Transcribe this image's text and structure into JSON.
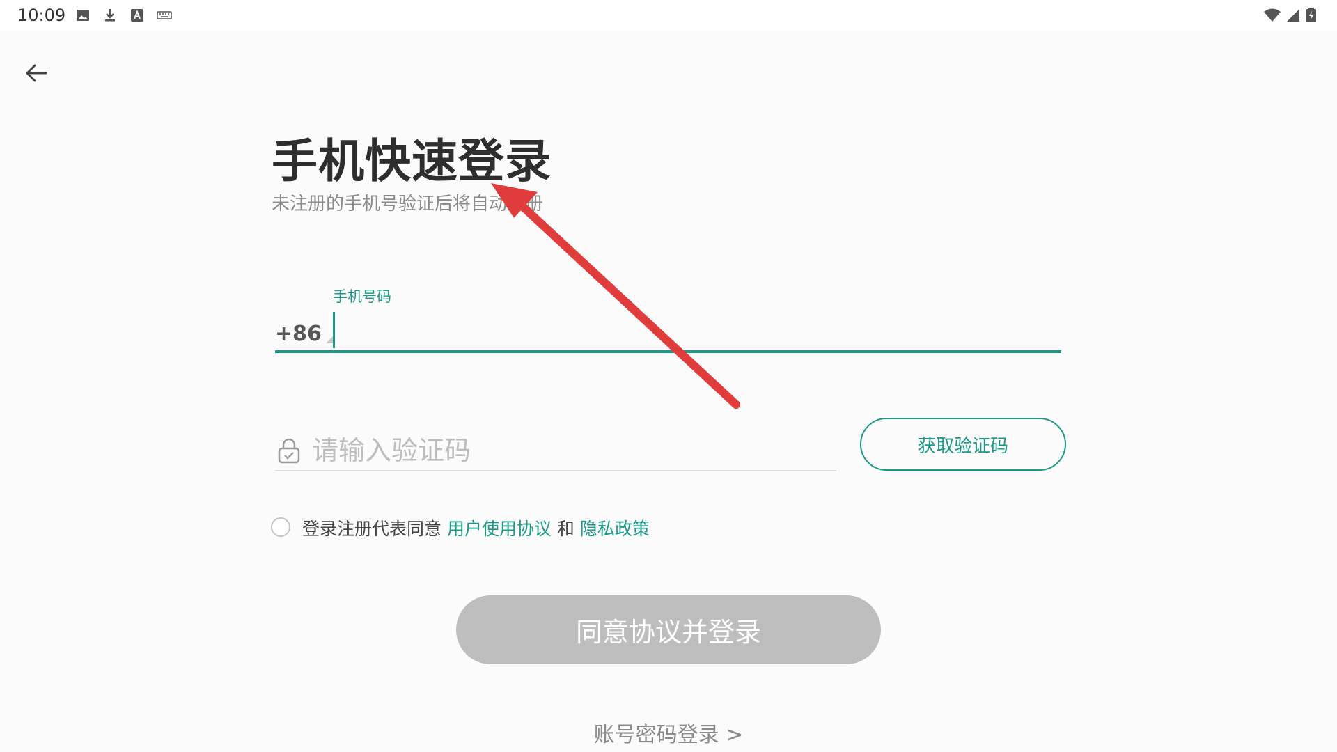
{
  "status_bar": {
    "time": "10:09",
    "left_icons": [
      "image-icon",
      "download-icon",
      "text-a-icon",
      "keyboard-icon"
    ],
    "right_icons": [
      "wifi-icon",
      "signal-icon",
      "battery-icon"
    ]
  },
  "header": {
    "back_icon": "arrow-left-icon"
  },
  "login": {
    "title": "手机快速登录",
    "subtitle": "未注册的手机号验证后将自动注册",
    "phone_label": "手机号码",
    "country_code": "+86",
    "phone_value": "",
    "code_placeholder": "请输入验证码",
    "code_value": "",
    "get_code_label": "获取验证码",
    "agreement_prefix": "登录注册代表同意 ",
    "user_agreement_link": "用户使用协议",
    "agreement_and": " 和 ",
    "privacy_link": "隐私政策",
    "agreement_checked": false,
    "submit_label": "同意协议并登录",
    "password_login_link": "账号密码登录 >"
  },
  "colors": {
    "accent": "#1a9a86",
    "disabled_button": "#bdbdbd",
    "annotation_arrow": "#e03c3c"
  }
}
